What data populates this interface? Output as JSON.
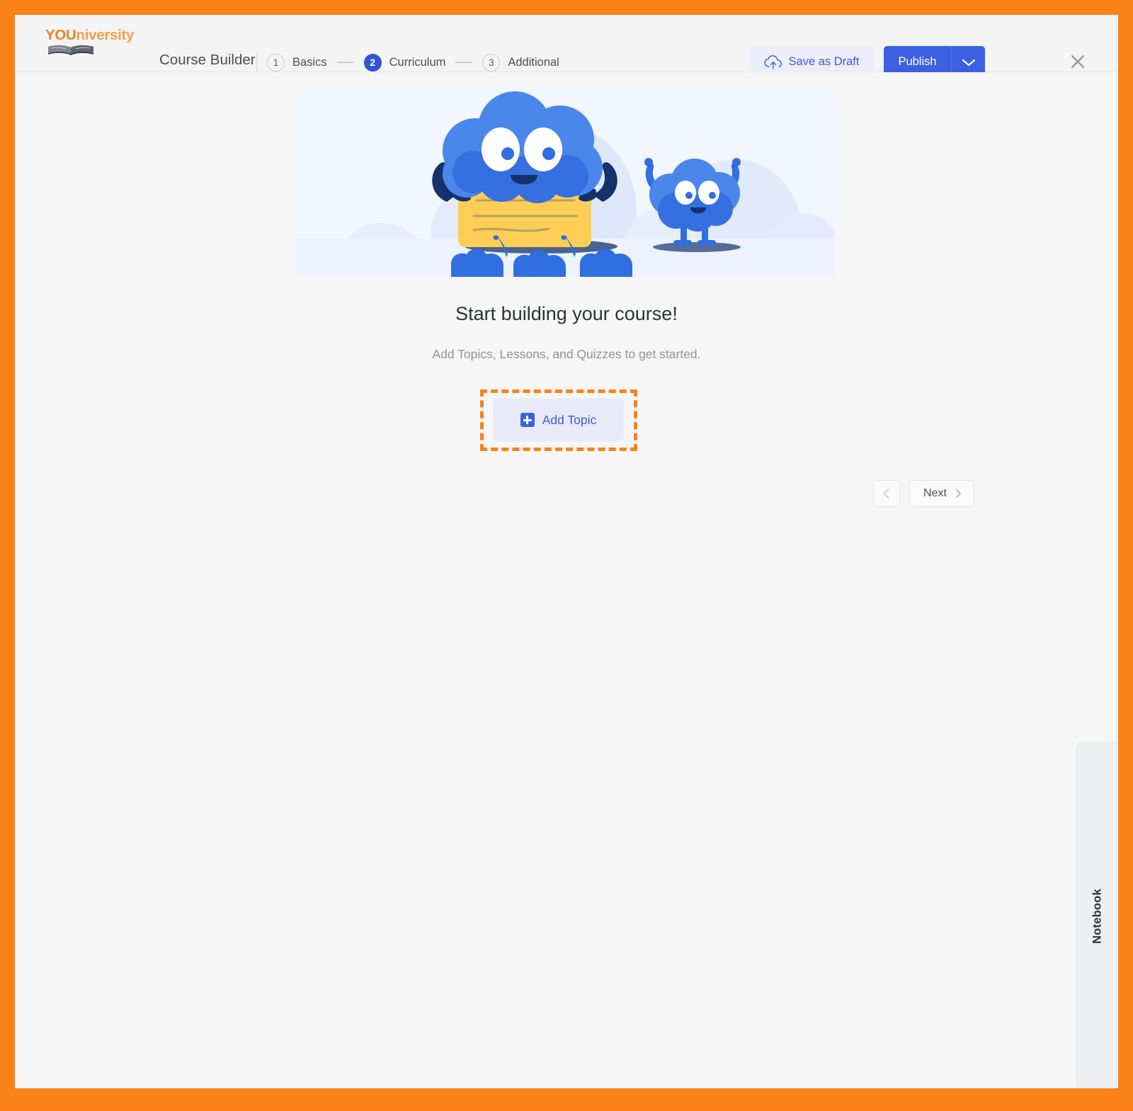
{
  "brand": {
    "name_bold": "YOU",
    "name_rest": "niversity",
    "book_icon": "open-book-icon"
  },
  "header": {
    "title": "Course Builder",
    "steps": [
      {
        "number": "1",
        "label": "Basics",
        "active": false
      },
      {
        "number": "2",
        "label": "Curriculum",
        "active": true
      },
      {
        "number": "3",
        "label": "Additional",
        "active": false
      }
    ],
    "save_draft_label": "Save as Draft",
    "save_draft_icon": "cloud-upload-icon",
    "publish_label": "Publish",
    "publish_dropdown_icon": "chevron-down-icon",
    "close_icon": "close-icon"
  },
  "main": {
    "illustration": {
      "name": "empty-state-illustration",
      "description": "Two blue cloud characters with a yellow card",
      "colors": {
        "banner_background": "#f1f6ff",
        "character_blue": "#2f6fe0",
        "character_light_blue": "#4a87ea",
        "character_dark": "#16326b",
        "card_yellow": "#fcce55",
        "cloud_backdrop": "#dde6fa"
      }
    },
    "title": "Start building your course!",
    "subtitle": "Add Topics, Lessons, and Quizzes to get started.",
    "add_topic_label": "Add Topic",
    "add_topic_icon": "plus-icon",
    "highlight_color": "#fb8216",
    "pagination": {
      "prev_icon": "chevron-left-icon",
      "next_label": "Next",
      "next_icon": "chevron-right-icon"
    }
  },
  "notebook": {
    "label": "Notebook"
  },
  "theme": {
    "frame_orange": "#fb8216",
    "accent_blue": "#3c60e0",
    "page_background": "#f6f6f6"
  }
}
